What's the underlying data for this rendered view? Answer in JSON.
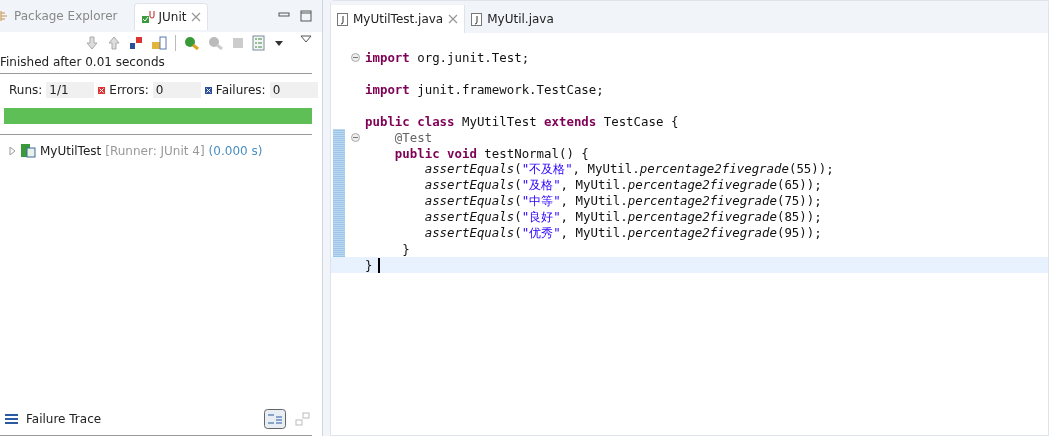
{
  "left_tabs": [
    {
      "label": "Package Explorer",
      "selected": false,
      "closable": false
    },
    {
      "label": "JUnit",
      "selected": true,
      "closable": true
    }
  ],
  "status": "Finished after 0.01 seconds",
  "counters": [
    {
      "kind": "runs",
      "label": "Runs:",
      "value": "1/1"
    },
    {
      "kind": "errors",
      "label": "Errors:",
      "value": "0"
    },
    {
      "kind": "failures",
      "label": "Failures:",
      "value": "0"
    }
  ],
  "progress": {
    "level": 1,
    "color": "#5fbf57"
  },
  "tree": [
    {
      "name": "MyUtilTest",
      "runner": "[Runner: JUnit 4]",
      "time": "(0.000 s)",
      "expanded": false
    }
  ],
  "failure_trace": {
    "title": "Failure Trace"
  },
  "editor_tabs": [
    {
      "label": "MyUtilTest.java",
      "selected": true,
      "closable": true
    },
    {
      "label": "MyUtil.java",
      "selected": false,
      "closable": false
    }
  ],
  "code": [
    {
      "kind": "code",
      "expanded": true,
      "tokens": [
        {
          "kind": "kw",
          "text": "import"
        },
        {
          "kind": "plain",
          "text": " org.junit.Test;"
        }
      ]
    },
    {
      "kind": "blank"
    },
    {
      "kind": "code",
      "tokens": [
        {
          "kind": "kw",
          "text": "import"
        },
        {
          "kind": "plain",
          "text": " junit.framework.TestCase;"
        }
      ]
    },
    {
      "kind": "blank"
    },
    {
      "kind": "code",
      "tokens": [
        {
          "kind": "kw",
          "text": "public class"
        },
        {
          "kind": "plain",
          "text": " MyUtilTest "
        },
        {
          "kind": "kw",
          "text": "extends"
        },
        {
          "kind": "plain",
          "text": " TestCase {"
        }
      ]
    },
    {
      "kind": "code",
      "expanded": true,
      "changed": true,
      "tokens": [
        {
          "kind": "ann",
          "text": "    @Test"
        }
      ]
    },
    {
      "kind": "code",
      "changed": true,
      "tokens": [
        {
          "kind": "kw",
          "text": "    public void"
        },
        {
          "kind": "plain",
          "text": " testNormal() {"
        }
      ]
    },
    {
      "kind": "code",
      "changed": true,
      "tokens": [
        {
          "kind": "static",
          "text": "        assertEquals"
        },
        {
          "kind": "plain",
          "text": "("
        },
        {
          "kind": "str",
          "text": "\"不及格\""
        },
        {
          "kind": "plain",
          "text": ", MyUtil."
        },
        {
          "kind": "static",
          "text": "percentage2fivegrade"
        },
        {
          "kind": "plain",
          "text": "(55));"
        }
      ]
    },
    {
      "kind": "code",
      "changed": true,
      "tokens": [
        {
          "kind": "static",
          "text": "        assertEquals"
        },
        {
          "kind": "plain",
          "text": "("
        },
        {
          "kind": "str",
          "text": "\"及格\""
        },
        {
          "kind": "plain",
          "text": ", MyUtil."
        },
        {
          "kind": "static",
          "text": "percentage2fivegrade"
        },
        {
          "kind": "plain",
          "text": "(65));"
        }
      ]
    },
    {
      "kind": "code",
      "changed": true,
      "tokens": [
        {
          "kind": "static",
          "text": "        assertEquals"
        },
        {
          "kind": "plain",
          "text": "("
        },
        {
          "kind": "str",
          "text": "\"中等\""
        },
        {
          "kind": "plain",
          "text": ", MyUtil."
        },
        {
          "kind": "static",
          "text": "percentage2fivegrade"
        },
        {
          "kind": "plain",
          "text": "(75));"
        }
      ]
    },
    {
      "kind": "code",
      "changed": true,
      "tokens": [
        {
          "kind": "static",
          "text": "        assertEquals"
        },
        {
          "kind": "plain",
          "text": "("
        },
        {
          "kind": "str",
          "text": "\"良好\""
        },
        {
          "kind": "plain",
          "text": ", MyUtil."
        },
        {
          "kind": "static",
          "text": "percentage2fivegrade"
        },
        {
          "kind": "plain",
          "text": "(85));"
        }
      ]
    },
    {
      "kind": "code",
      "changed": true,
      "tokens": [
        {
          "kind": "static",
          "text": "        assertEquals"
        },
        {
          "kind": "plain",
          "text": "("
        },
        {
          "kind": "str",
          "text": "\"优秀\""
        },
        {
          "kind": "plain",
          "text": ", MyUtil."
        },
        {
          "kind": "static",
          "text": "percentage2fivegrade"
        },
        {
          "kind": "plain",
          "text": "(95));"
        }
      ]
    },
    {
      "kind": "code",
      "changed": true,
      "tokens": [
        {
          "kind": "plain",
          "text": "     }"
        }
      ]
    },
    {
      "kind": "code",
      "current": true,
      "tokens": [
        {
          "kind": "plain",
          "text": "}"
        }
      ]
    }
  ]
}
